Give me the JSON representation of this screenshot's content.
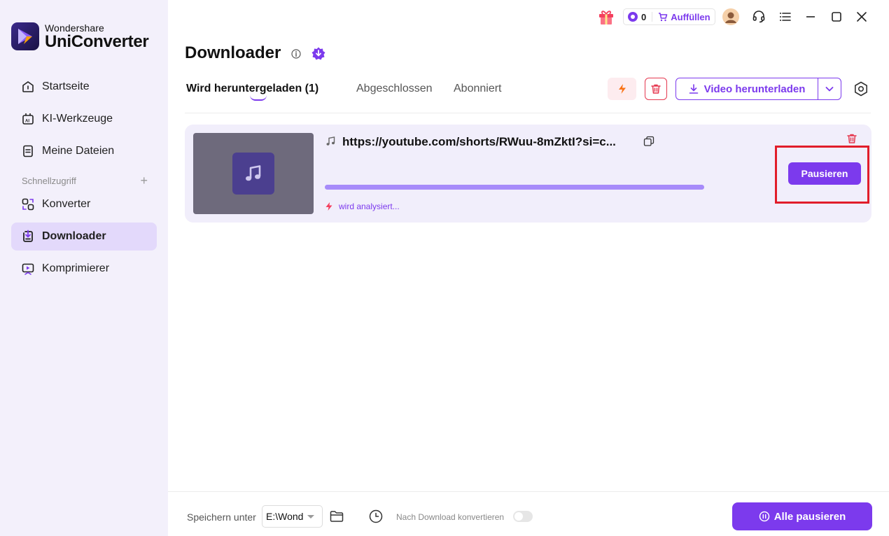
{
  "app": {
    "brand": "Wondershare",
    "product": "UniConverter"
  },
  "topbar": {
    "coins": "0",
    "buy_label": "Auffüllen"
  },
  "sidebar": {
    "items": [
      {
        "label": "Startseite",
        "icon": "home-icon"
      },
      {
        "label": "KI-Werkzeuge",
        "icon": "ai-tools-icon"
      },
      {
        "label": "Meine Dateien",
        "icon": "files-icon"
      }
    ],
    "quick_access_label": "Schnellzugriff",
    "quick_items": [
      {
        "label": "Konverter",
        "icon": "converter-icon"
      },
      {
        "label": "Downloader",
        "icon": "downloader-icon",
        "active": true
      },
      {
        "label": "Komprimierer",
        "icon": "compressor-icon"
      }
    ]
  },
  "main": {
    "title": "Downloader",
    "tabs": [
      {
        "label": "Wird heruntergeladen (1)",
        "active": true
      },
      {
        "label": "Abgeschlossen"
      },
      {
        "label": "Abonniert"
      }
    ],
    "download_button_label": "Video herunterladen"
  },
  "download_item": {
    "url": "https://youtube.com/shorts/RWuu-8mZktI?si=c...",
    "status": "wird analysiert...",
    "pause_label": "Pausieren",
    "progress_percent": 100
  },
  "footer": {
    "save_label": "Speichern unter",
    "save_path": "E:\\Wondershare",
    "convert_after_label": "Nach Download konvertieren",
    "convert_after_enabled": false,
    "pause_all_label": "Alle pausieren"
  },
  "colors": {
    "accent": "#7c3aed",
    "danger": "#e53950",
    "sidebar_bg": "#f3f0fb",
    "card_bg": "#f1eefb",
    "highlight": "#e11d2a"
  }
}
